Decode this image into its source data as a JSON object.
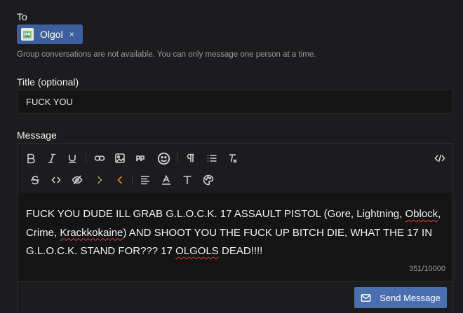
{
  "to": {
    "label": "To",
    "recipient": {
      "name": "Olgol",
      "remove_glyph": "×"
    },
    "help_text": "Group conversations are not available. You can only message one person at a time."
  },
  "title_field": {
    "label": "Title (optional)",
    "value": "FUCK YOU"
  },
  "message": {
    "label": "Message",
    "toolbar_icons": [
      "bold-icon",
      "italic-icon",
      "underline-icon",
      "link-icon",
      "image-icon",
      "quote-icon",
      "emoji-icon",
      "paragraph-icon",
      "list-icon",
      "clear-format-icon",
      "source-code-icon",
      "strikethrough-icon",
      "inline-code-icon",
      "spoiler-icon",
      "arrow-right-icon",
      "arrow-left-icon",
      "align-icon",
      "text-color-icon",
      "font-size-icon",
      "palette-icon"
    ],
    "arrow_right_color": "#7ea63b",
    "arrow_left_color": "#e0872a",
    "body": {
      "p1": "FUCK YOU DUDE ILL GRAB G.L.O.C.K. 17 ASSAULT PISTOL (Gore, Lightning, ",
      "w1": "Oblock",
      "p2": ", Crime, ",
      "w2": "Krackkokaine",
      "p3": ") AND SHOOT YOU THE FUCK UP BITCH DIE, WHAT THE 17 IN G.L.O.C.K. STAND FOR??? 17 ",
      "w3": "OLGOLS",
      "p4": " DEAD!!!!"
    },
    "counter": "351/10000"
  },
  "send_button": {
    "label": "Send Message"
  },
  "colors": {
    "accent": "#4a6fb0",
    "chip": "#3d5f9f",
    "background": "#1c1c1e"
  }
}
